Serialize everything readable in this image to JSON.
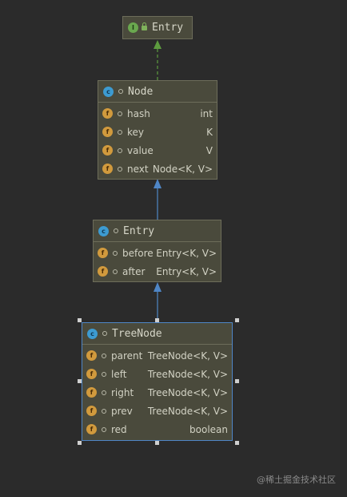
{
  "colors": {
    "background": "#2b2b2b",
    "box_fill": "#4a4a3c",
    "implements_arrow": "#5d9c3f",
    "extends_arrow": "#4f86c6"
  },
  "diagram": {
    "entry_interface": {
      "icon": "interface-icon",
      "name": "Entry"
    },
    "node_class": {
      "icon": "class-icon",
      "name": "Node",
      "fields": [
        {
          "name": "hash",
          "type": "int"
        },
        {
          "name": "key",
          "type": "K"
        },
        {
          "name": "value",
          "type": "V"
        },
        {
          "name": "next",
          "type": "Node<K, V>"
        }
      ]
    },
    "entry_class": {
      "icon": "class-icon",
      "name": "Entry",
      "fields": [
        {
          "name": "before",
          "type": "Entry<K, V>"
        },
        {
          "name": "after",
          "type": "Entry<K, V>"
        }
      ]
    },
    "treenode_class": {
      "icon": "class-icon",
      "name": "TreeNode",
      "selected": true,
      "fields": [
        {
          "name": "parent",
          "type": "TreeNode<K, V>"
        },
        {
          "name": "left",
          "type": "TreeNode<K, V>"
        },
        {
          "name": "right",
          "type": "TreeNode<K, V>"
        },
        {
          "name": "prev",
          "type": "TreeNode<K, V>"
        },
        {
          "name": "red",
          "type": "boolean"
        }
      ]
    }
  },
  "watermark": "@稀土掘金技术社区"
}
